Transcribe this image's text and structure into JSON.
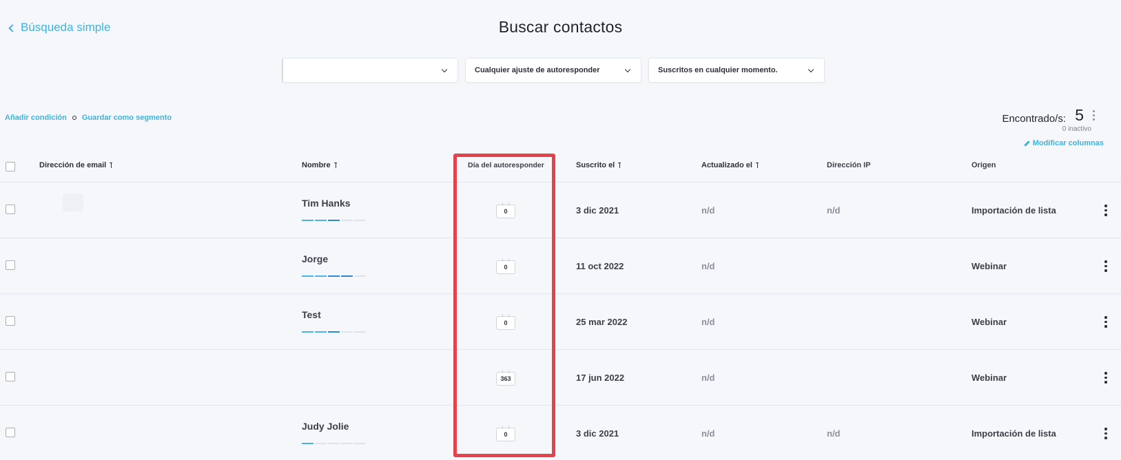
{
  "nav": {
    "back_label": "Búsqueda simple"
  },
  "page": {
    "title": "Buscar contactos"
  },
  "filters": {
    "first_value": "",
    "autoresponder": "Cualquier ajuste de autoresponder",
    "subscribed": "Suscritos en cualquier momento."
  },
  "actions": {
    "add_condition": "Añadir condición",
    "save_segment": "Guardar como segmento"
  },
  "summary": {
    "found_label": "Encontrado/s:",
    "found_count": "5",
    "inactive": "0 inactivo",
    "modify_columns": "Modificar columnas"
  },
  "columns": {
    "email": "Dirección de email",
    "name": "Nombre",
    "autoresponder_day": "Día del autoresponder",
    "subscribed_on": "Suscrito el",
    "updated_on": "Actualizado el",
    "ip": "Dirección IP",
    "origin": "Origen"
  },
  "rows": [
    {
      "name": "Tim Hanks",
      "engagement": 3,
      "day": "0",
      "subscribed": "3 dic 2021",
      "updated": "n/d",
      "ip": "n/d",
      "origin": "Importación de lista"
    },
    {
      "name": "Jorge",
      "engagement": 4,
      "day": "0",
      "subscribed": "11 oct 2022",
      "updated": "n/d",
      "ip": "",
      "origin": "Webinar"
    },
    {
      "name": "Test",
      "engagement": 3,
      "day": "0",
      "subscribed": "25 mar 2022",
      "updated": "n/d",
      "ip": "",
      "origin": "Webinar"
    },
    {
      "name": "",
      "engagement": 0,
      "day": "363",
      "subscribed": "17 jun 2022",
      "updated": "n/d",
      "ip": "",
      "origin": "Webinar"
    },
    {
      "name": "Judy Jolie",
      "engagement": 1,
      "day": "0",
      "subscribed": "3 dic 2021",
      "updated": "n/d",
      "ip": "n/d",
      "origin": "Importación de lista"
    }
  ],
  "colors": {
    "accent": "#3fb2dc",
    "highlight": "#e4434b",
    "bar_light": "#48b4e4",
    "bar_dark": "#2f86d6"
  }
}
